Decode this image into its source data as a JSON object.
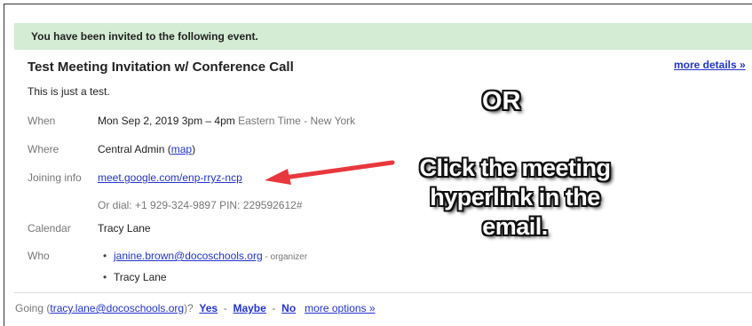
{
  "banner": {
    "text": "You have been invited to the following event."
  },
  "event": {
    "title": "Test Meeting Invitation w/ Conference Call",
    "more_details": "more details »",
    "description": "This is just a test."
  },
  "when": {
    "label": "When",
    "value": "Mon Sep 2, 2019 3pm – 4pm",
    "timezone": "Eastern Time - New York"
  },
  "where": {
    "label": "Where",
    "value": "Central Admin",
    "map_open": "(",
    "map_link": "map",
    "map_close": ")"
  },
  "joining": {
    "label": "Joining info",
    "link": "meet.google.com/enp-rryz-ncp",
    "dial": "Or dial: +1 929-324-9897  PIN: 229592612#"
  },
  "calendar": {
    "label": "Calendar",
    "value": "Tracy Lane"
  },
  "who": {
    "label": "Who",
    "bullet": "•",
    "organizer_email": "janine.brown@docoschools.org",
    "organizer_tag": " - organizer",
    "attendee": "Tracy Lane"
  },
  "rsvp": {
    "prefix": "Going (",
    "email": "tracy.lane@docoschools.org",
    "suffix": ")?",
    "yes": "Yes",
    "maybe": "Maybe",
    "no": "No",
    "dash": "-",
    "more_options": "more options »"
  },
  "annotations": {
    "or": "OR",
    "line1": "Click the meeting",
    "line2": "hyperlink in the",
    "line3": "email.",
    "arrow_color": "#e8383d"
  }
}
